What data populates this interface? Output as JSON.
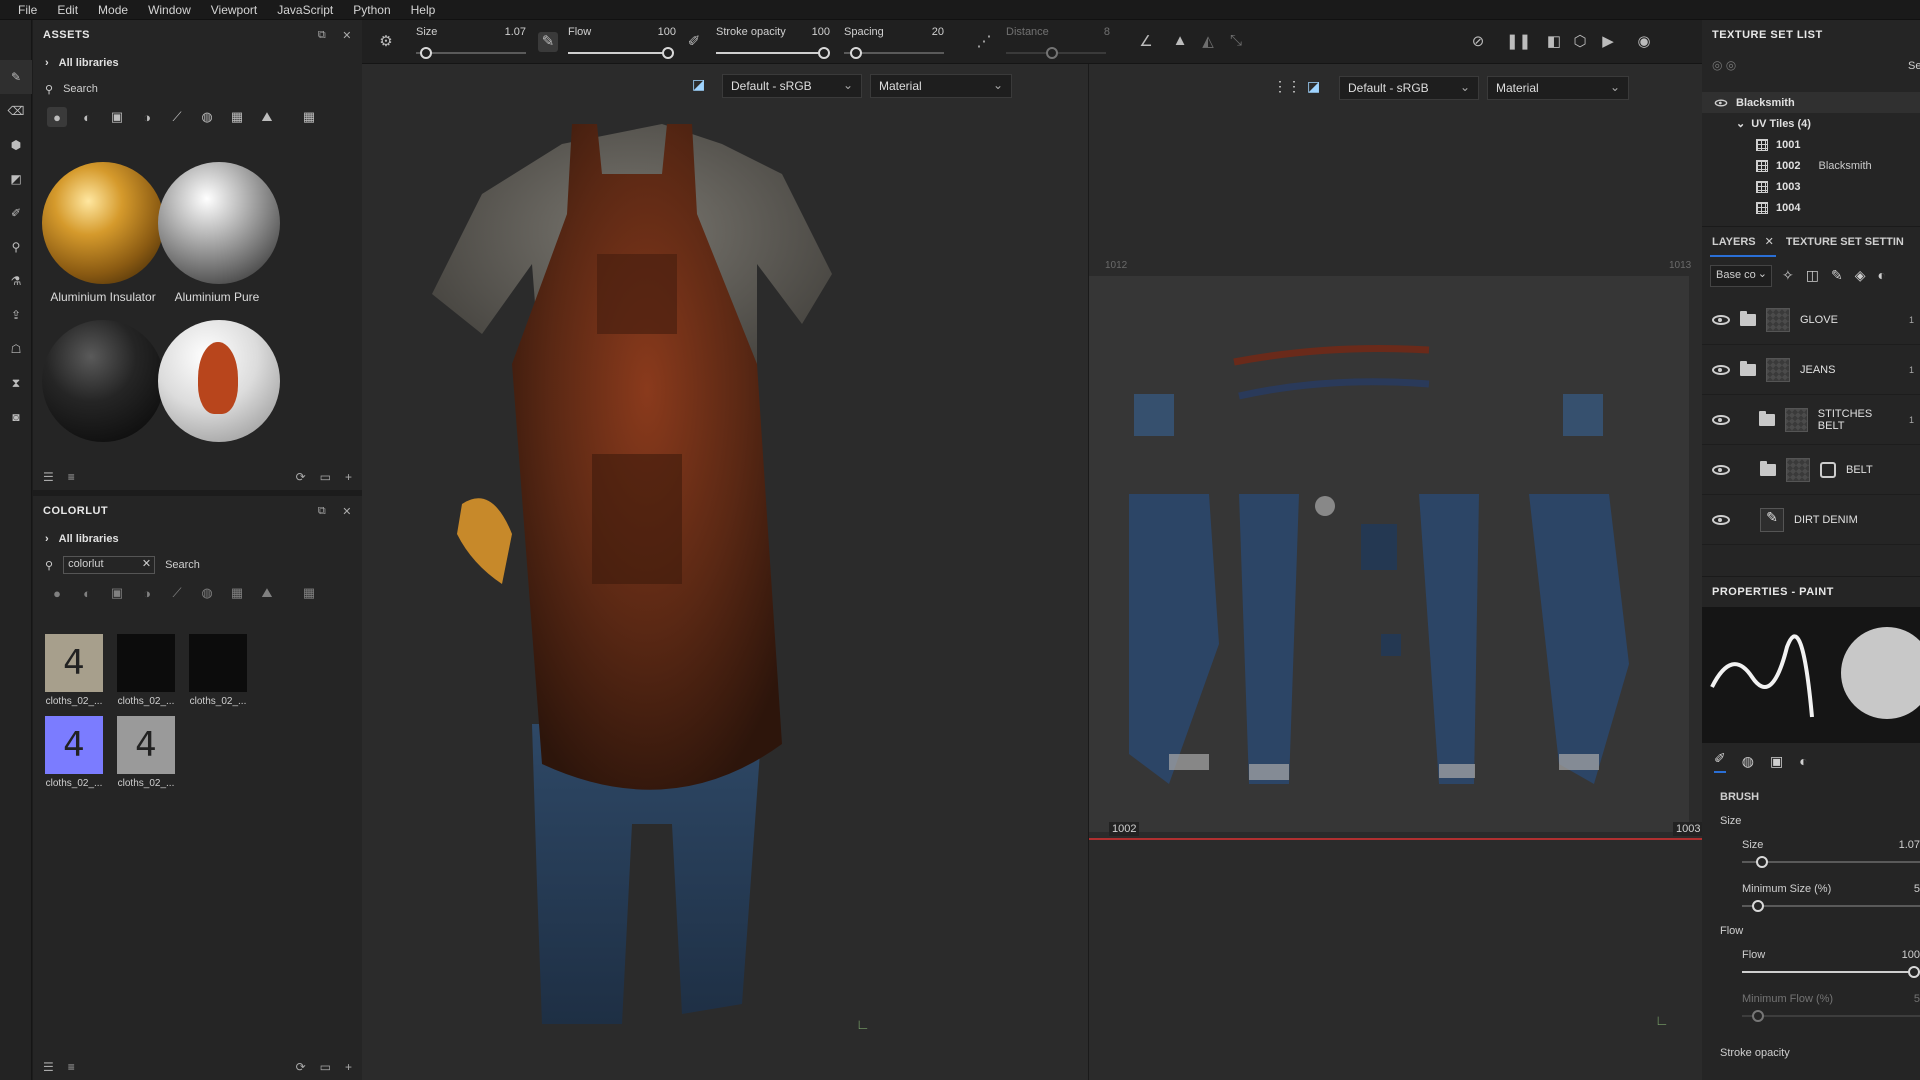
{
  "menu": [
    "File",
    "Edit",
    "Mode",
    "Window",
    "Viewport",
    "JavaScript",
    "Python",
    "Help"
  ],
  "assets": {
    "title": "ASSETS",
    "library": "All libraries",
    "search_placeholder": "Search",
    "items": [
      {
        "label": "Aluminium Insulator"
      },
      {
        "label": "Aluminium Pure"
      },
      {
        "label": ""
      },
      {
        "label": ""
      }
    ]
  },
  "colorlut": {
    "title": "COLORLUT",
    "library": "All libraries",
    "search_value": "colorlut",
    "search_label": "Search",
    "thumbs": [
      {
        "label": "cloths_02_...",
        "glyph": "4"
      },
      {
        "label": "cloths_02_...",
        "glyph": ""
      },
      {
        "label": "cloths_02_...",
        "glyph": ""
      },
      {
        "label": "cloths_02_...",
        "glyph": "4"
      },
      {
        "label": "cloths_02_...",
        "glyph": "4"
      }
    ]
  },
  "toolbar": {
    "size_label": "Size",
    "size_value": "1.07",
    "flow_label": "Flow",
    "flow_value": "100",
    "stroke_opacity_label": "Stroke opacity",
    "stroke_opacity_value": "100",
    "spacing_label": "Spacing",
    "spacing_value": "20",
    "distance_label": "Distance",
    "distance_value": "8"
  },
  "viewport3d": {
    "colorspace": "Default - sRGB",
    "mode": "Material"
  },
  "viewport2d": {
    "colorspace": "Default - sRGB",
    "mode": "Material",
    "tile_left": "1002",
    "tile_right": "1003",
    "tile_top_left": "1012",
    "tile_top_right": "1013"
  },
  "texture_set_list": {
    "title": "TEXTURE SET LIST",
    "set_name": "Blacksmith",
    "uv_tiles_label": "UV Tiles (4)",
    "tiles": [
      {
        "id": "1001",
        "note": ""
      },
      {
        "id": "1002",
        "note": "Blacksmith"
      },
      {
        "id": "1003",
        "note": ""
      },
      {
        "id": "1004",
        "note": ""
      }
    ],
    "right_cut": "Se"
  },
  "layers": {
    "tab_layers": "LAYERS",
    "tab_settings": "TEXTURE SET SETTIN",
    "channel": "Base co",
    "rows": [
      {
        "name": "GLOVE",
        "count": "1"
      },
      {
        "name": "JEANS",
        "count": "1"
      },
      {
        "name": "STITCHES BELT",
        "count": "1"
      },
      {
        "name": "BELT",
        "count": ""
      },
      {
        "name": "DIRT DENIM",
        "count": ""
      }
    ]
  },
  "properties": {
    "title": "PROPERTIES - PAINT",
    "section": "BRUSH",
    "size_group": "Size",
    "size_label": "Size",
    "size_value": "1.07",
    "min_size_label": "Minimum Size (%)",
    "min_size_value": "5",
    "flow_group": "Flow",
    "flow_label": "Flow",
    "flow_value": "100",
    "min_flow_label": "Minimum Flow (%)",
    "min_flow_value": "5",
    "stroke_opacity_label": "Stroke opacity"
  },
  "colors": {
    "accent": "#2a6fd6",
    "lut_selected": "#7b7cff",
    "tile_line": "#b03030"
  }
}
